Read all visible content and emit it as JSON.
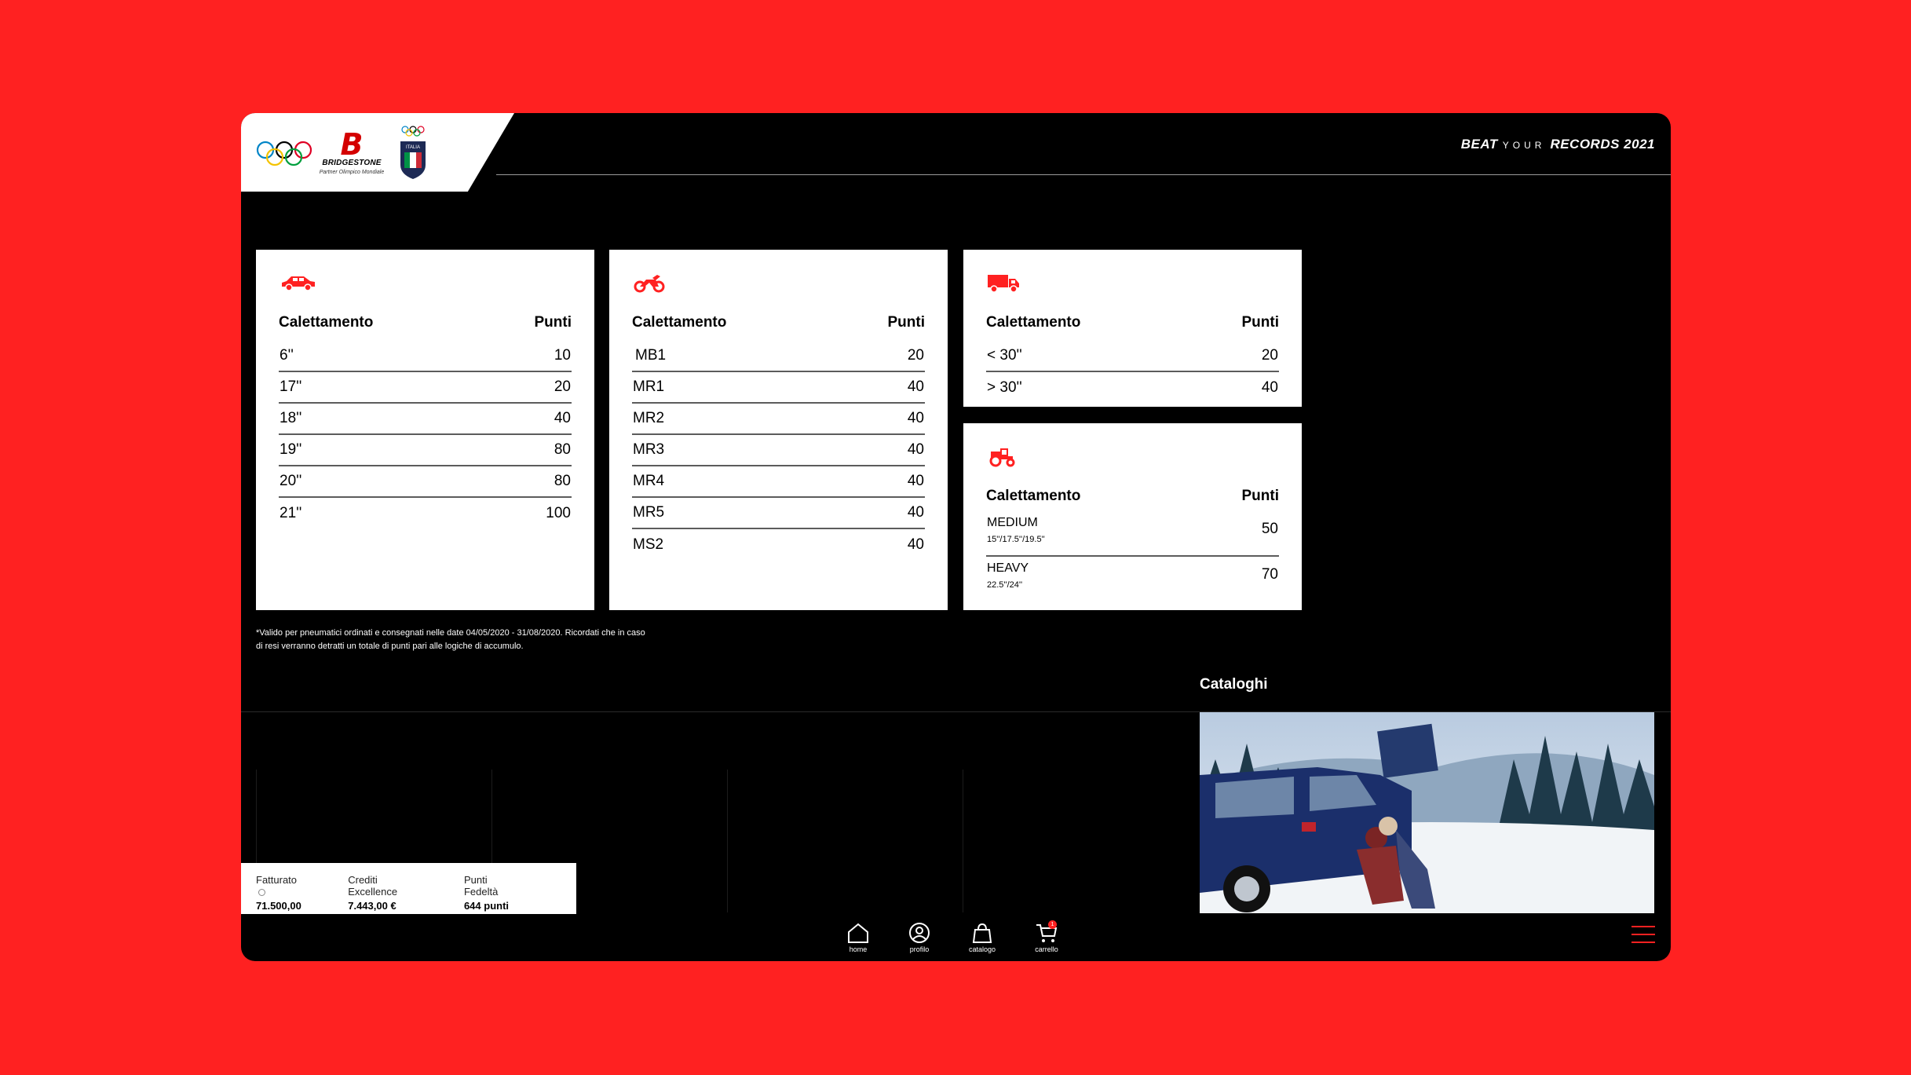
{
  "header": {
    "brand_name": "BRIDGESTONE",
    "brand_sub": "Partner Olimpico Mondiale",
    "italia_label": "ITALIA",
    "campaign_1": "BEAT",
    "campaign_2": "YOUR",
    "campaign_3": "RECORDS 2021"
  },
  "cards": {
    "car": {
      "icon": "car-icon",
      "col1": "Calettamento",
      "col2": "Punti",
      "rows": [
        {
          "label": "6''",
          "points": "10"
        },
        {
          "label": "17''",
          "points": "20"
        },
        {
          "label": "18''",
          "points": "40"
        },
        {
          "label": "19''",
          "points": "80"
        },
        {
          "label": "20''",
          "points": "80"
        },
        {
          "label": "21''",
          "points": "100"
        }
      ]
    },
    "moto": {
      "icon": "motorcycle-icon",
      "col1": "Calettamento",
      "col2": "Punti",
      "rows": [
        {
          "label": "MB1",
          "points": "20"
        },
        {
          "label": "MR1",
          "points": "40"
        },
        {
          "label": "MR2",
          "points": "40"
        },
        {
          "label": "MR3",
          "points": "40"
        },
        {
          "label": "MR4",
          "points": "40"
        },
        {
          "label": "MR5",
          "points": "40"
        },
        {
          "label": "MS2",
          "points": "40"
        }
      ]
    },
    "truck": {
      "icon": "truck-icon",
      "col1": "Calettamento",
      "col2": "Punti",
      "rows": [
        {
          "label": "< 30''",
          "points": "20"
        },
        {
          "label": "> 30''",
          "points": "40"
        }
      ]
    },
    "tractor": {
      "icon": "tractor-icon",
      "col1": "Calettamento",
      "col2": "Punti",
      "rows": [
        {
          "label": "MEDIUM",
          "sub": "15''/17.5''/19.5''",
          "points": "50"
        },
        {
          "label": "HEAVY",
          "sub": "22.5''/24''",
          "points": "70"
        }
      ]
    }
  },
  "note": "*Valido per pneumatici ordinati e consegnati nelle date 04/05/2020 - 31/08/2020. Ricordati che in caso di resi verranno detratti un totale di punti pari alle logiche di accumulo.",
  "catalog": {
    "title": "Cataloghi"
  },
  "stats": [
    {
      "label": "Fatturato",
      "value": "71.500,00 €"
    },
    {
      "label": "Crediti Excellence",
      "value": "7.443,00 €"
    },
    {
      "label": "Punti Fedeltà",
      "value": "644 punti"
    }
  ],
  "nav": {
    "home": "home",
    "profile": "profilo",
    "catalog": "catalogo",
    "cart": "carrello",
    "cart_count": "1"
  },
  "colors": {
    "accent": "#ff2121",
    "panel": "#000000",
    "card": "#ffffff"
  }
}
